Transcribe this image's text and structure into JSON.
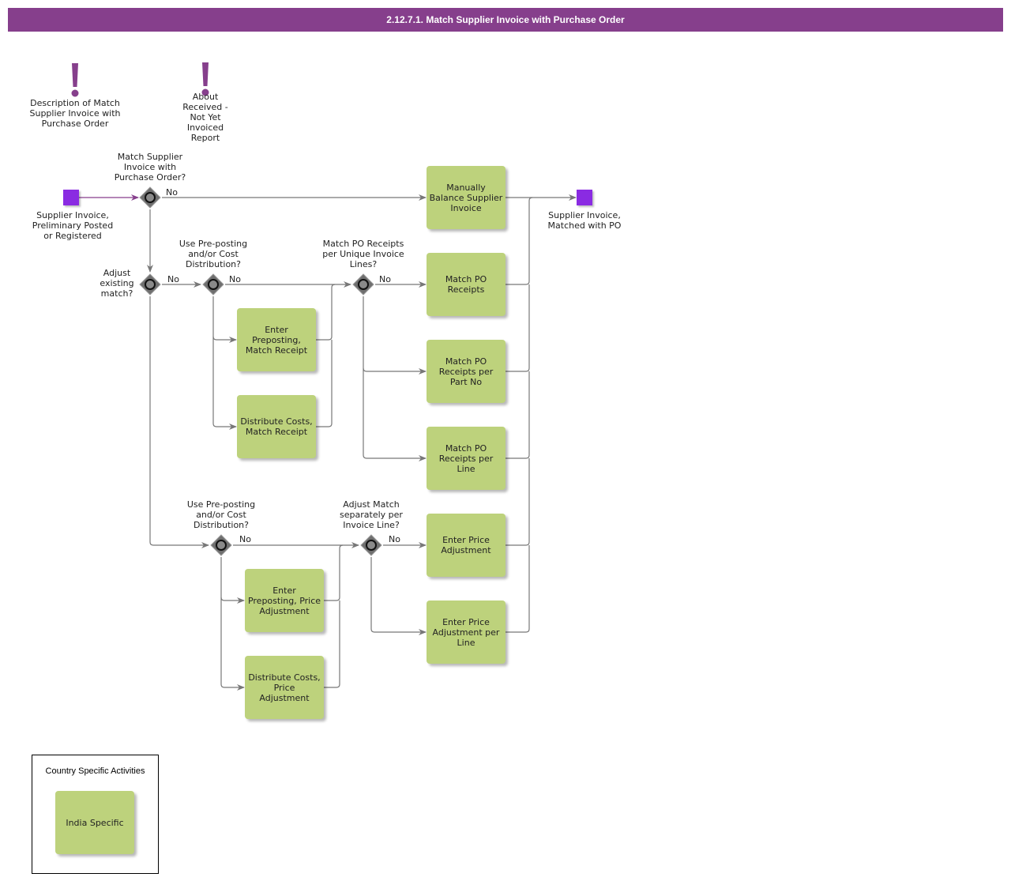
{
  "header": {
    "title": "2.12.7.1. Match Supplier Invoice with Purchase Order"
  },
  "colors": {
    "header": "#863f8c",
    "task": "#bdd27c",
    "event": "#8a2be2",
    "gateway": "#6f6f6f",
    "annotation": "#863f8c"
  },
  "annotations": [
    {
      "id": "desc",
      "icon": "exclamation-icon",
      "label": "Description of Match\nSupplier Invoice with\nPurchase Order"
    },
    {
      "id": "about",
      "icon": "exclamation-icon",
      "label": "About\nReceived -\nNot Yet\nInvoiced\nReport"
    }
  ],
  "events": {
    "start": {
      "label": "Supplier Invoice,\nPreliminary Posted\nor Registered"
    },
    "end": {
      "label": "Supplier Invoice,\nMatched with PO"
    }
  },
  "gateways": {
    "g1": {
      "label": "Match Supplier\nInvoice with\nPurchase Order?",
      "branch": "No"
    },
    "g2": {
      "label": "Adjust\nexisting\nmatch?",
      "branch": "No"
    },
    "g3": {
      "label": "Use Pre-posting\nand/or Cost\nDistribution?",
      "branch": "No"
    },
    "g4": {
      "label": "Match PO Receipts\nper Unique Invoice\nLines?",
      "branch": "No"
    },
    "g5": {
      "label": "Use Pre-posting\nand/or Cost\nDistribution?",
      "branch": "No"
    },
    "g6": {
      "label": "Adjust Match\nseparately per\nInvoice Line?",
      "branch": "No"
    }
  },
  "tasks": {
    "manual_balance": "Manually\nBalance Supplier\nInvoice",
    "match_po_receipts": "Match PO\nReceipts",
    "match_po_part": "Match PO\nReceipts per\nPart No",
    "match_po_line": "Match PO\nReceipts per\nLine",
    "enter_preposting_match": "Enter\nPreposting,\nMatch Receipt",
    "distribute_match": "Distribute Costs,\nMatch Receipt",
    "enter_price_adj": "Enter Price\nAdjustment",
    "enter_price_adj_line": "Enter Price\nAdjustment per\nLine",
    "enter_preposting_price": "Enter\nPreposting, Price\nAdjustment",
    "distribute_price": "Distribute Costs,\nPrice\nAdjustment"
  },
  "legend": {
    "title": "Country Specific Activities",
    "item": "India Specific"
  }
}
